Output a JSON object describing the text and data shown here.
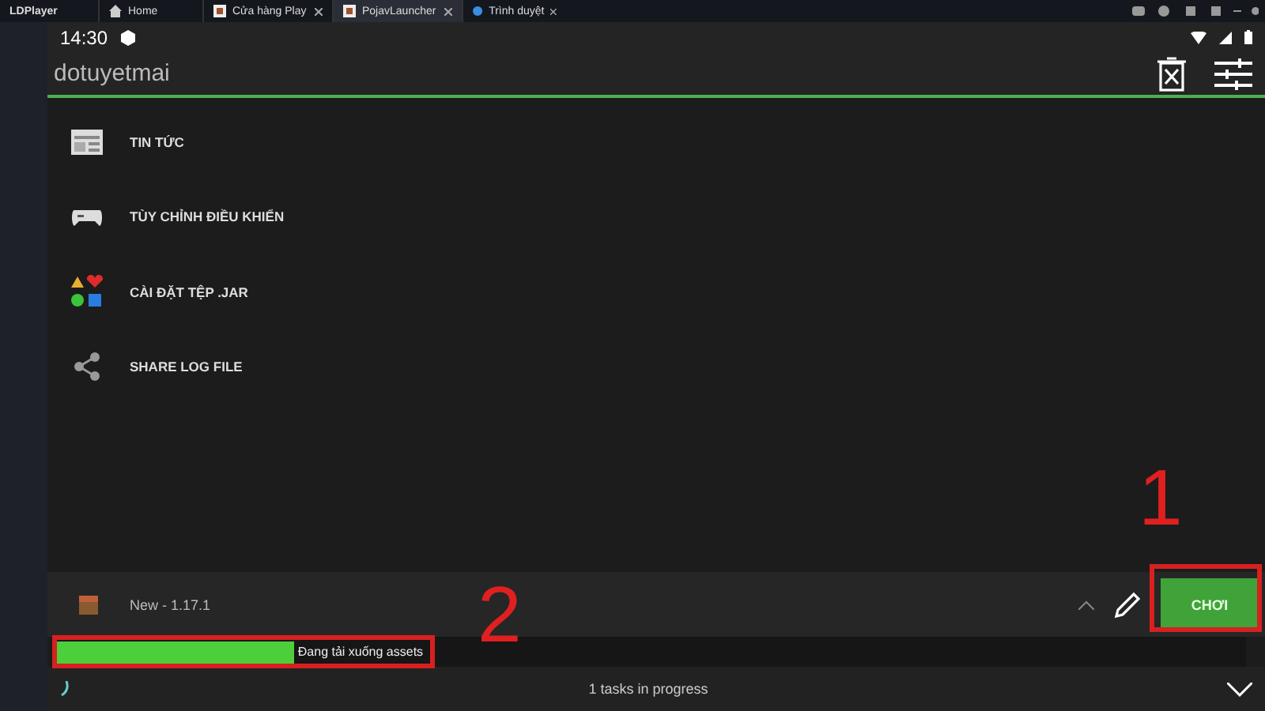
{
  "emulator": {
    "title": "LDPlayer",
    "tabs": [
      {
        "label": "Home",
        "selected": false,
        "kind": "home"
      },
      {
        "label": "Cửa hàng Play",
        "selected": false,
        "kind": "app"
      },
      {
        "label": "PojavLauncher",
        "selected": true,
        "kind": "app"
      },
      {
        "label": "Trình duyệt",
        "selected": false,
        "kind": "browser"
      }
    ]
  },
  "status_bar": {
    "time": "14:30"
  },
  "header": {
    "username": "dotuyetmai"
  },
  "menu": [
    {
      "label": "TIN TỨC",
      "kind": "news"
    },
    {
      "label": "TÙY CHỈNH ĐIỀU KHIỂN",
      "kind": "gamepad"
    },
    {
      "label": "CÀI ĐẶT TỆP .JAR",
      "kind": "shapes"
    },
    {
      "label": "SHARE LOG FILE",
      "kind": "share"
    }
  ],
  "profile": {
    "name": "New - 1.17.1",
    "play_button": "CHƠI"
  },
  "progress": {
    "level": 0.2,
    "label": "Đang tải xuống assets"
  },
  "tasks": {
    "label": "1 tasks in progress"
  },
  "annotations": [
    {
      "label": "1"
    },
    {
      "label": "2"
    }
  ]
}
